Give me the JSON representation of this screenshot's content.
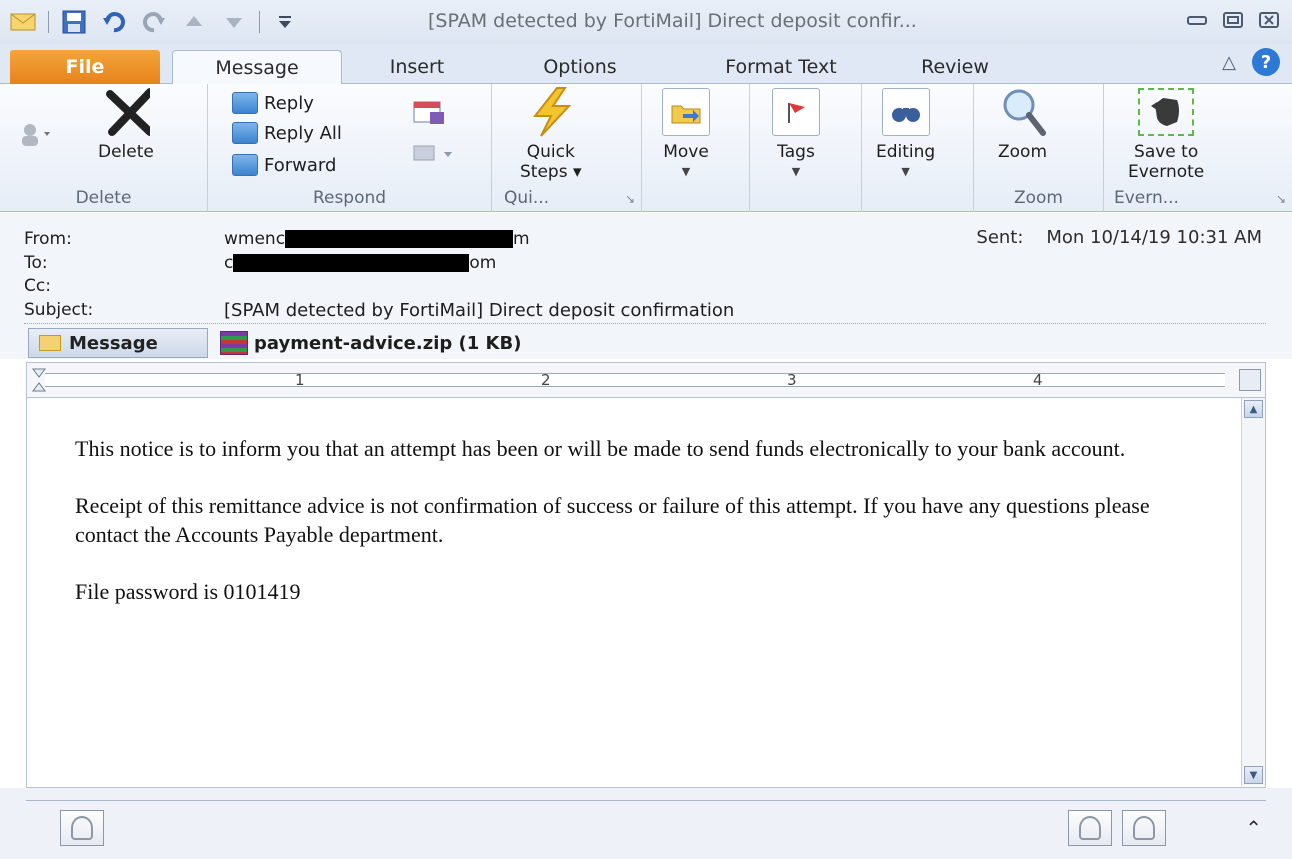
{
  "window": {
    "title": "[SPAM detected by FortiMail] Direct deposit confir...",
    "controls": [
      "minimize",
      "restore",
      "close"
    ]
  },
  "quick_access": {
    "icons": [
      "mail-icon",
      "save-icon",
      "undo-icon",
      "redo-icon",
      "up-arrow-icon",
      "down-arrow-icon",
      "customize-icon"
    ]
  },
  "tabs": [
    "File",
    "Message",
    "Insert",
    "Options",
    "Format Text",
    "Review"
  ],
  "active_tab": "Message",
  "ribbon": {
    "delete": {
      "button": "Delete",
      "group": "Delete"
    },
    "respond": {
      "reply": "Reply",
      "reply_all": "Reply All",
      "forward": "Forward",
      "group": "Respond"
    },
    "quick_steps": {
      "button_line1": "Quick",
      "button_line2": "Steps ▾",
      "group": "Qui..."
    },
    "move": {
      "button": "Move"
    },
    "tags": {
      "button": "Tags"
    },
    "editing": {
      "button": "Editing"
    },
    "zoom": {
      "button": "Zoom",
      "group": "Zoom"
    },
    "evernote": {
      "button_line1": "Save to",
      "button_line2": "Evernote",
      "group": "Evern..."
    }
  },
  "header": {
    "from_label": "From:",
    "from_prefix": "wmenc",
    "from_suffix": "m",
    "to_label": "To:",
    "to_prefix": "c",
    "to_suffix": "om",
    "cc_label": "Cc:",
    "subject_label": "Subject:",
    "subject": "[SPAM detected by FortiMail] Direct deposit confirmation",
    "sent_label": "Sent:",
    "sent_value": "Mon 10/14/19 10:31 AM"
  },
  "attachments": {
    "message_tab": "Message",
    "file": "payment-advice.zip (1 KB)"
  },
  "ruler": {
    "marks": [
      "1",
      "2",
      "3",
      "4"
    ]
  },
  "body": {
    "p1": "This notice is to inform you that an attempt has been or will be made to send funds electronically to your bank account.",
    "p2": "Receipt of this remittance advice is not confirmation of success or failure of this attempt. If you have any questions please contact the Accounts Payable department.",
    "p3": "File password is 0101419"
  }
}
